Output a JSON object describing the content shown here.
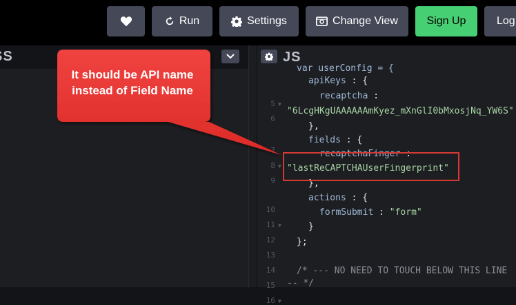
{
  "toolbar": {
    "heart_icon": "heart-icon",
    "run_label": "Run",
    "settings_label": "Settings",
    "change_view_label": "Change View",
    "signup_label": "Sign Up",
    "login_label": "Log"
  },
  "panes": {
    "css_title": "SS",
    "js_title": "JS"
  },
  "code": {
    "top_partial": "var userConfig = {",
    "line_numbers": [
      "5",
      "6",
      "7",
      "8",
      "9",
      "10",
      "11",
      "12",
      "13",
      "14",
      "15",
      "16"
    ],
    "line5_key": "apiKeys",
    "line6_key": "recaptcha",
    "line6_value": "\"6LcgHKgUAAAAAAmKyez_mXnGlI0bMxosjNq_YW6S\"",
    "line9_key": "recaptchaFinger",
    "line9_value": "\"lastReCAPTCHAUserFingerprint\"",
    "line8_key": "fields",
    "line11_key": "actions",
    "line12_key": "formSubmit",
    "line12_value": "\"form\"",
    "line16_comment": "/* --- NO NEED TO TOUCH BELOW THIS LINE",
    "line16_cont": "-- */"
  },
  "annotation": {
    "callout_line1": "It should be API name",
    "callout_line2": "instead of Field Name",
    "callout_color": "#e8302c",
    "highlight_color": "#d43a33"
  }
}
